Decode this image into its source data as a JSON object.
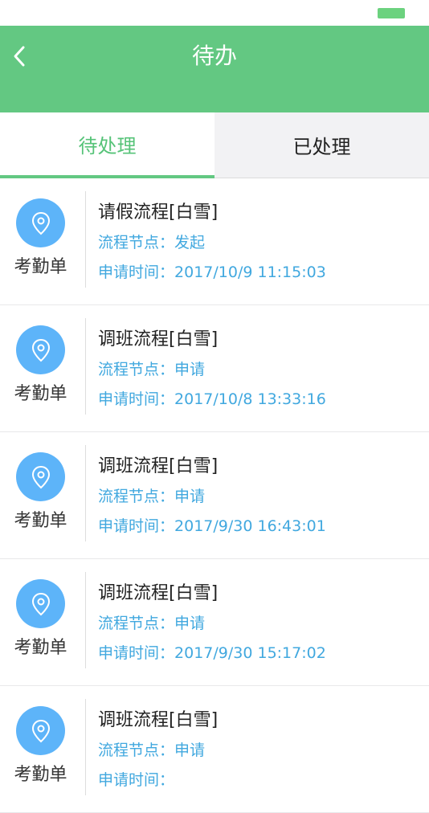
{
  "header": {
    "title": "待办"
  },
  "tabs": [
    {
      "label": "待处理",
      "active": true
    },
    {
      "label": "已处理",
      "active": false
    }
  ],
  "colors": {
    "accent_green": "#63c882",
    "link_blue": "#41a8df",
    "icon_blue": "#5db4f9",
    "battery_green": "#6cd27f"
  },
  "items": [
    {
      "type": "考勤单",
      "icon": "location-pin-icon",
      "title": "请假流程[白雪]",
      "node_label": "流程节点：",
      "node": "发起",
      "time_label": "申请时间：",
      "time": "2017/10/9 11:15:03"
    },
    {
      "type": "考勤单",
      "icon": "location-pin-icon",
      "title": "调班流程[白雪]",
      "node_label": "流程节点：",
      "node": "申请",
      "time_label": "申请时间：",
      "time": "2017/10/8 13:33:16"
    },
    {
      "type": "考勤单",
      "icon": "location-pin-icon",
      "title": "调班流程[白雪]",
      "node_label": "流程节点：",
      "node": "申请",
      "time_label": "申请时间：",
      "time": "2017/9/30 16:43:01"
    },
    {
      "type": "考勤单",
      "icon": "location-pin-icon",
      "title": "调班流程[白雪]",
      "node_label": "流程节点：",
      "node": "申请",
      "time_label": "申请时间：",
      "time": "2017/9/30 15:17:02"
    },
    {
      "type": "考勤单",
      "icon": "location-pin-icon",
      "title": "调班流程[白雪]",
      "node_label": "流程节点：",
      "node": "申请",
      "time_label": "申请时间：",
      "time": ""
    }
  ]
}
